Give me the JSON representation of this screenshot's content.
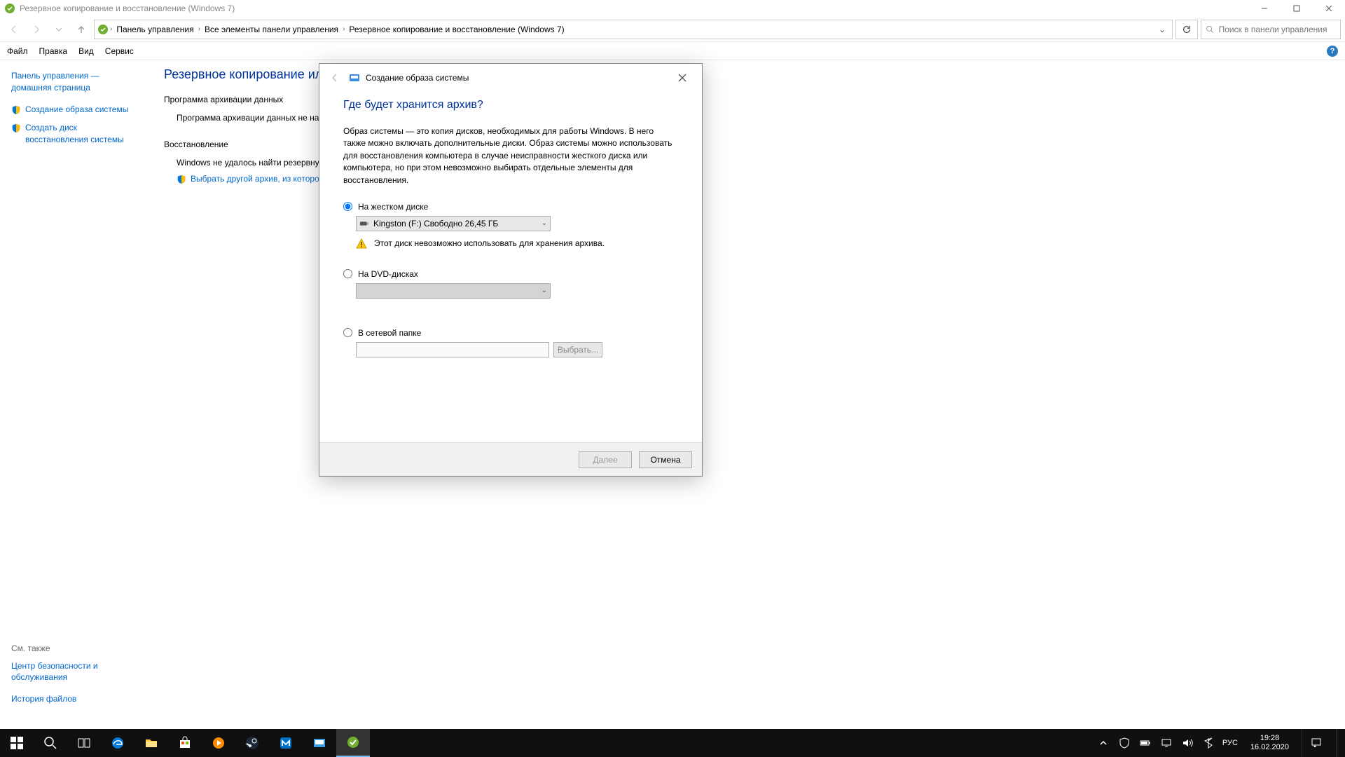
{
  "window": {
    "title": "Резервное копирование и восстановление (Windows 7)"
  },
  "nav": {
    "crumbs": [
      "Панель управления",
      "Все элементы панели управления",
      "Резервное копирование и восстановление (Windows 7)"
    ]
  },
  "search": {
    "placeholder": "Поиск в панели управления"
  },
  "menu": {
    "items": [
      "Файл",
      "Правка",
      "Вид",
      "Сервис"
    ]
  },
  "sidebar": {
    "home": "Панель управления — домашняя страница",
    "items": [
      "Создание образа системы",
      "Создать диск восстановления системы"
    ],
    "see_also": "См. также",
    "links": [
      "Центр безопасности и обслуживания",
      "История файлов"
    ]
  },
  "main": {
    "heading": "Резервное копирование или восст",
    "backup_section": "Программа архивации данных",
    "backup_status": "Программа архивации данных не настро",
    "restore_section": "Восстановление",
    "restore_status": "Windows не удалось найти резервную ко",
    "restore_link": "Выбрать другой архив, из которого буд"
  },
  "dialog": {
    "title": "Создание образа системы",
    "heading": "Где будет хранится архив?",
    "desc": "Образ системы — это копия дисков, необходимых для работы Windows. В него также можно включать дополнительные диски. Образ системы можно использовать для восстановления компьютера в случае неисправности жесткого диска или компьютера, но при этом невозможно выбирать отдельные элементы для восстановления.",
    "opt_hdd": "На жестком диске",
    "hdd_combo": "Kingston (F:)  Свободно 26,45 ГБ",
    "hdd_warn": "Этот диск невозможно использовать для хранения архива.",
    "opt_dvd": "На DVD-дисках",
    "opt_net": "В сетевой папке",
    "browse": "Выбрать...",
    "next": "Далее",
    "cancel": "Отмена"
  },
  "taskbar": {
    "lang": "РУС",
    "time": "19:28",
    "date": "16.02.2020"
  }
}
